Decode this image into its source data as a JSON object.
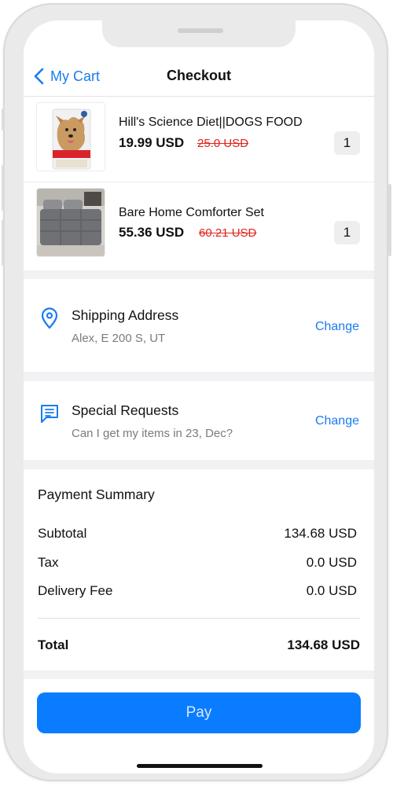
{
  "header": {
    "back_label": "My Cart",
    "title": "Checkout"
  },
  "cart_items": [
    {
      "name": "Hill's Science Diet||DOGS FOOD",
      "price": "19.99 USD",
      "old_price": "25.0 USD",
      "qty": "1"
    },
    {
      "name": "Bare Home Comforter Set",
      "price": "55.36 USD",
      "old_price": "60.21 USD",
      "qty": "1"
    }
  ],
  "shipping": {
    "title": "Shipping Address",
    "value": "Alex, E 200 S, UT",
    "action": "Change"
  },
  "requests": {
    "title": "Special Requests",
    "value": "Can I get my items in 23, Dec?",
    "action": "Change"
  },
  "summary": {
    "title": "Payment Summary",
    "rows": [
      {
        "label": "Subtotal",
        "value": "134.68 USD"
      },
      {
        "label": "Tax",
        "value": "0.0 USD"
      },
      {
        "label": "Delivery Fee",
        "value": "0.0 USD"
      }
    ],
    "total_label": "Total",
    "total_value": "134.68 USD"
  },
  "pay_label": "Pay",
  "colors": {
    "accent": "#1a7cf0",
    "pay_button": "#0a7cff",
    "strike_price": "#e2231a"
  },
  "icons": {
    "back": "chevron-left-icon",
    "shipping": "location-pin-icon",
    "requests": "message-icon"
  }
}
